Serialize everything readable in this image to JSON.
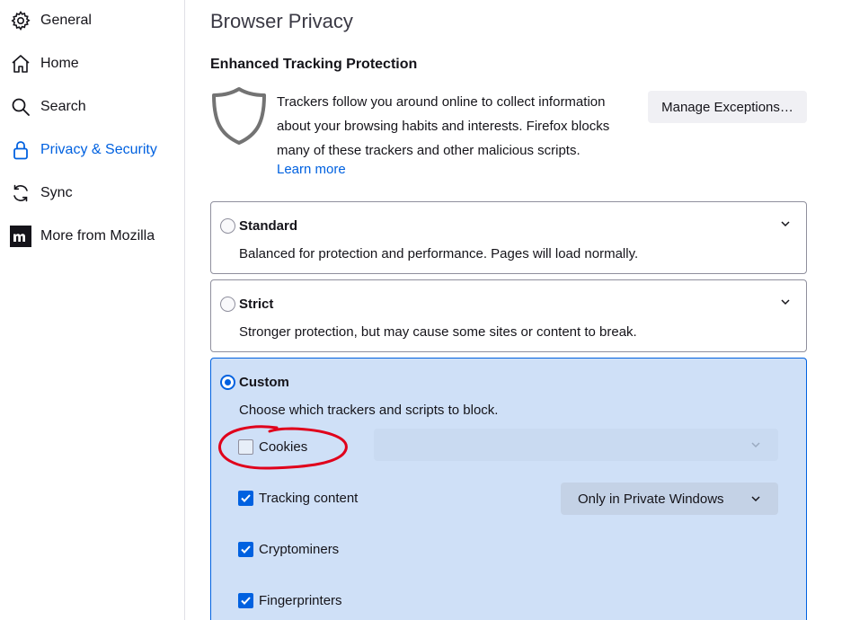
{
  "sidebar": {
    "items": [
      {
        "label": "General",
        "icon": "gear-icon"
      },
      {
        "label": "Home",
        "icon": "home-icon"
      },
      {
        "label": "Search",
        "icon": "search-icon"
      },
      {
        "label": "Privacy & Security",
        "icon": "lock-icon",
        "selected": true
      },
      {
        "label": "Sync",
        "icon": "sync-icon"
      },
      {
        "label": "More from Mozilla",
        "icon": "mozilla-icon"
      }
    ]
  },
  "main": {
    "title": "Browser Privacy",
    "etp": {
      "heading": "Enhanced Tracking Protection",
      "description": "Trackers follow you around online to collect information about your browsing habits and interests. Firefox blocks many of these trackers and other malicious scripts.",
      "learn_more": "Learn more",
      "manage_exceptions": "Manage Exceptions…"
    },
    "modes": [
      {
        "title": "Standard",
        "description": "Balanced for protection and performance. Pages will load normally.",
        "checked": false
      },
      {
        "title": "Strict",
        "description": "Stronger protection, but may cause some sites or content to break.",
        "checked": false
      },
      {
        "title": "Custom",
        "description": "Choose which trackers and scripts to block.",
        "checked": true
      }
    ],
    "custom_options": [
      {
        "label": "Cookies",
        "checked": false,
        "dropdown": ""
      },
      {
        "label": "Tracking content",
        "checked": true,
        "dropdown": "Only in Private Windows"
      },
      {
        "label": "Cryptominers",
        "checked": true
      },
      {
        "label": "Fingerprinters",
        "checked": true
      }
    ]
  },
  "colors": {
    "accent": "#0061e0",
    "selected_card_bg": "#cfe0f7",
    "annotation": "#e0001b"
  }
}
